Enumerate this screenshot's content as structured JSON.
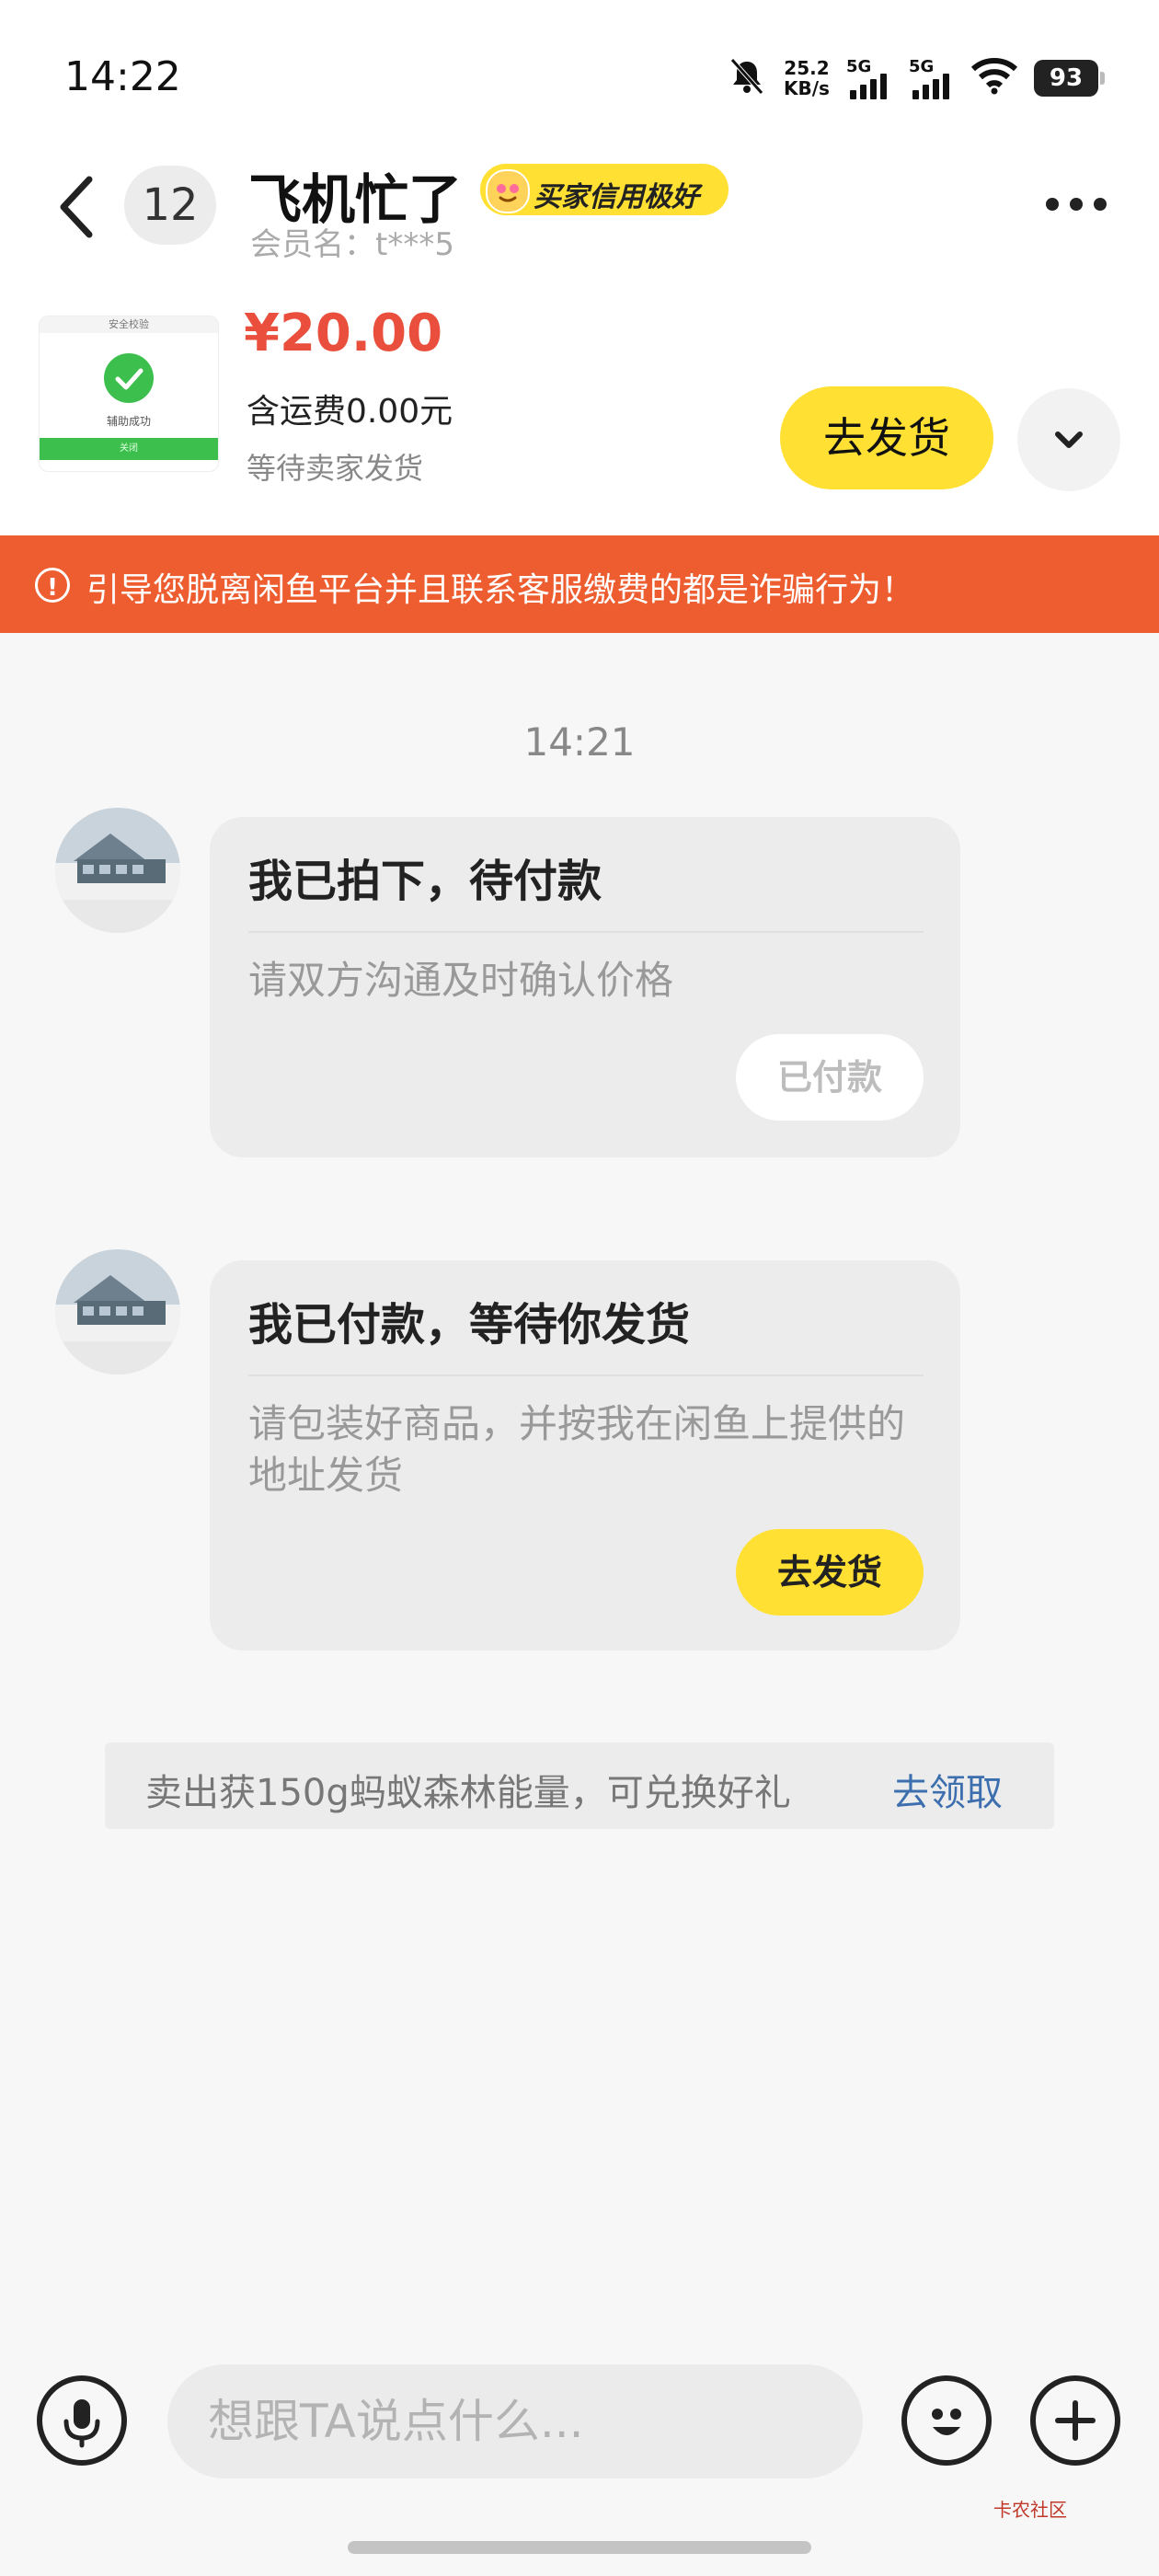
{
  "status_bar": {
    "time": "14:22",
    "net_speed_value": "25.2",
    "net_speed_unit": "KB/s",
    "signal1_label": "5G",
    "signal2_label": "5G",
    "battery": "93"
  },
  "header": {
    "unread_count": "12",
    "seller_name": "飞机忙了",
    "credit_badge": "买家信用极好",
    "member_name": "会员名：t***5"
  },
  "product": {
    "thumb_header": "安全校验",
    "thumb_subtitle": "辅助成功",
    "thumb_button": "关闭",
    "price": "¥20.00",
    "shipping_fee": "含运费0.00元",
    "order_status": "等待卖家发货",
    "ship_button": "去发货"
  },
  "warning": {
    "icon_text": "!",
    "text": "引导您脱离闲鱼平台并且联系客服缴费的都是诈骗行为！"
  },
  "chat": {
    "timestamp": "14:21",
    "messages": [
      {
        "title": "我已拍下，待付款",
        "desc": "请双方沟通及时确认价格",
        "button": "已付款"
      },
      {
        "title": "我已付款，等待你发货",
        "desc": "请包装好商品，并按我在闲鱼上提供的地址发货",
        "button": "去发货"
      }
    ]
  },
  "notice": {
    "text": "卖出获150g蚂蚁森林能量，可兑换好礼",
    "link": "去领取"
  },
  "input": {
    "placeholder": "想跟TA说点什么..."
  },
  "watermark": {
    "text": "卡农社区"
  },
  "colors": {
    "accent_yellow": "#ffe033",
    "price_red": "#e94f3c",
    "warning_orange": "#ee5d2f",
    "link_blue": "#3d6fae"
  },
  "icons": [
    "back-arrow-icon",
    "bell-muted-icon",
    "signal-icon",
    "wifi-icon",
    "battery-icon",
    "more-icon",
    "chevron-down-icon",
    "warning-icon",
    "microphone-icon",
    "emoji-icon",
    "plus-icon",
    "check-icon"
  ]
}
